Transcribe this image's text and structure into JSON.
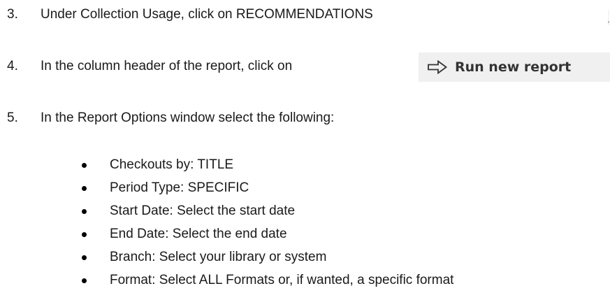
{
  "steps": [
    {
      "number": "3.",
      "text": "Under Collection Usage, click on RECOMMENDATIONS"
    },
    {
      "number": "4.",
      "text": "In the column header of the report, click on"
    },
    {
      "number": "5.",
      "text": "In the Report Options window select the following:"
    }
  ],
  "run_button": {
    "label": "Run new report",
    "icon": "right-arrow-icon"
  },
  "options": [
    "Checkouts by: TITLE",
    "Period Type: SPECIFIC",
    "Start Date: Select the start date",
    "End Date: Select the end date",
    "Branch: Select your library or system",
    "Format: Select ALL Formats or, if wanted, a specific format"
  ]
}
